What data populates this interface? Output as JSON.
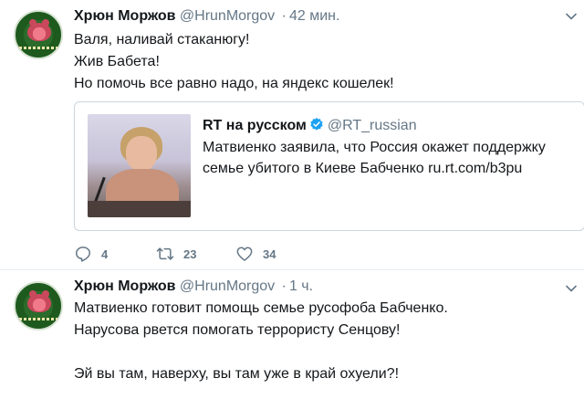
{
  "tweets": [
    {
      "author_name": "Хрюн Моржов",
      "author_handle": "@HrunMorgov",
      "separator": "·",
      "time": "42 мин.",
      "lines": [
        "Валя, наливай стаканюгу!",
        "Жив Бабета!",
        "Но помочь все равно надо, на яндекс кошелек!"
      ],
      "card": {
        "name": "RT на русском",
        "handle": "@RT_russian",
        "text_lines": [
          "Матвиенко заявила, что Россия окажет поддержку",
          "семье убитого в Киеве Бабченко ru.rt.com/b3pu"
        ]
      },
      "actions": {
        "replies": "4",
        "retweets": "23",
        "likes": "34"
      }
    },
    {
      "author_name": "Хрюн Моржов",
      "author_handle": "@HrunMorgov",
      "separator": "·",
      "time": "1 ч.",
      "lines": [
        "Матвиенко готовит помощь семье русофоба Бабченко.",
        "Нарусова рвется помогать террористу Сенцову!",
        "",
        "Эй вы там, наверху, вы там уже в край охуели?!"
      ]
    }
  ],
  "colors": {
    "text": "#14171a",
    "secondary": "#657786",
    "border": "#e6ecf0",
    "verified": "#1da1f2"
  },
  "icons": [
    "reply-icon",
    "retweet-icon",
    "like-icon",
    "chevron-down-icon",
    "verified-badge-icon"
  ]
}
